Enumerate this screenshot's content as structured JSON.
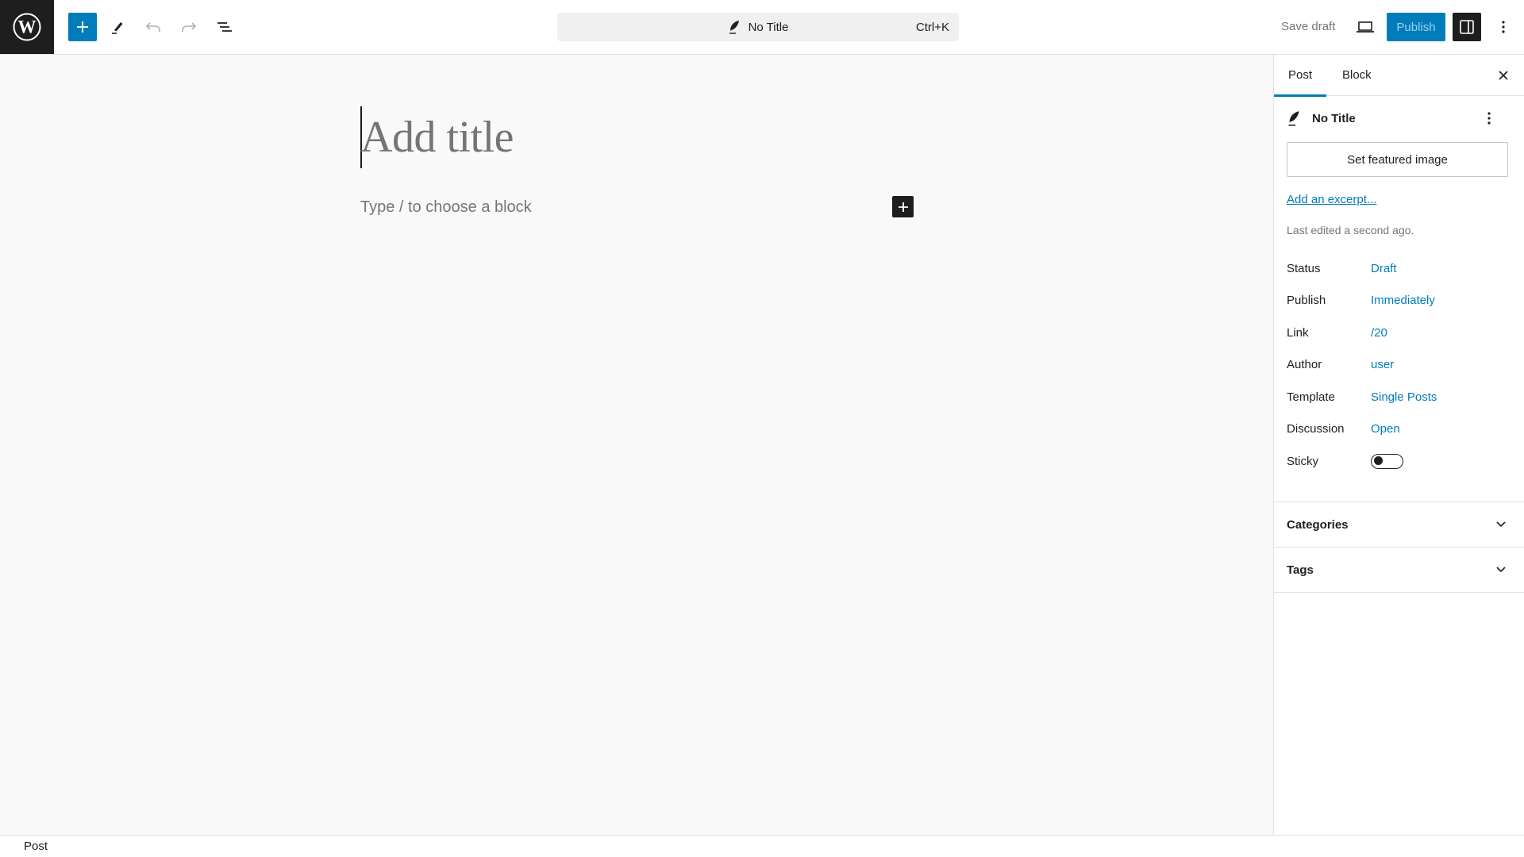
{
  "header": {
    "logo": "wordpress-logo",
    "toolbar": [
      {
        "name": "inserter",
        "icon": "plus-icon",
        "label": "Toggle block inserter"
      },
      {
        "name": "tools",
        "icon": "pencil-icon",
        "label": "Tools"
      },
      {
        "name": "undo",
        "icon": "undo-icon",
        "label": "Undo"
      },
      {
        "name": "redo",
        "icon": "redo-icon",
        "label": "Redo"
      },
      {
        "name": "list-view",
        "icon": "list-view-icon",
        "label": "Document Overview"
      }
    ],
    "document_bar": {
      "icon": "post-feather-icon",
      "title": "No Title",
      "shortcut": "Ctrl+K"
    },
    "save_draft_label": "Save draft",
    "preview_icon": "laptop-icon",
    "publish_label": "Publish",
    "settings_icon": "sidebar-icon",
    "options_icon": "more-vertical-icon"
  },
  "canvas": {
    "title_placeholder": "Add title",
    "block_placeholder": "Type / to choose a block",
    "block_inserter_icon": "plus-icon"
  },
  "sidebar": {
    "tabs": [
      {
        "label": "Post",
        "active": true
      },
      {
        "label": "Block",
        "active": false
      }
    ],
    "close_icon": "close-icon",
    "post": {
      "icon": "post-feather-icon",
      "title": "No Title",
      "featured_image_label": "Set featured image",
      "excerpt_link": "Add an excerpt...",
      "last_edited": "Last edited a second ago."
    },
    "rows": [
      {
        "label": "Status",
        "value": "Draft"
      },
      {
        "label": "Publish",
        "value": "Immediately"
      },
      {
        "label": "Link",
        "value": "/20"
      },
      {
        "label": "Author",
        "value": "user"
      },
      {
        "label": "Template",
        "value": "Single Posts"
      },
      {
        "label": "Discussion",
        "value": "Open"
      }
    ],
    "sticky": {
      "label": "Sticky",
      "checked": false
    },
    "panels": [
      {
        "title": "Categories",
        "expanded": false
      },
      {
        "title": "Tags",
        "expanded": false
      }
    ]
  },
  "footer": {
    "breadcrumb": "Post"
  },
  "colors": {
    "accent": "#007cba",
    "dark": "#1e1e1e",
    "muted": "#757575",
    "canvas_bg": "#f9f9f9"
  }
}
